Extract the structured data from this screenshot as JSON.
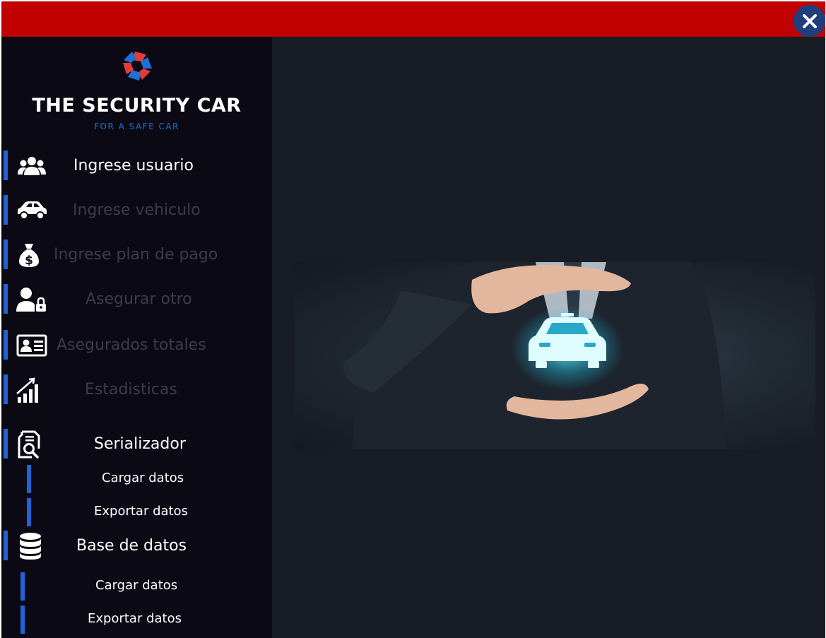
{
  "window": {
    "close_icon": "close-x-icon",
    "accent": "#c10000",
    "background": "#181d25"
  },
  "brand": {
    "title": "THE SECURITY CAR",
    "tagline": "FOR A SAFE CAR",
    "logo_icon": "shutter-logo-icon"
  },
  "nav": {
    "items": [
      {
        "label": "Ingrese usuario",
        "icon": "users-icon",
        "state": "active"
      },
      {
        "label": "Ingrese vehiculo",
        "icon": "car-icon",
        "state": "dim"
      },
      {
        "label": "Ingrese plan de pago",
        "icon": "money-bag-icon",
        "state": "dim"
      },
      {
        "label": "Asegurar otro",
        "icon": "user-lock-icon",
        "state": "dim"
      },
      {
        "label": "Asegurados totales",
        "icon": "id-card-icon",
        "state": "dim"
      },
      {
        "label": "Estadisticas",
        "icon": "chart-icon",
        "state": "dim"
      },
      {
        "label": "Serializador",
        "icon": "document-search-icon",
        "state": "active"
      },
      {
        "label": "Base de datos",
        "icon": "database-icon",
        "state": "active"
      }
    ],
    "serializador_sub": [
      {
        "label": "Cargar datos"
      },
      {
        "label": "Exportar datos"
      }
    ],
    "basedatos_sub": [
      {
        "label": "Cargar datos"
      },
      {
        "label": "Exportar datos"
      }
    ],
    "bar_color": "#1f63d6"
  },
  "main": {
    "hero_image": "hands-protecting-car-image"
  }
}
